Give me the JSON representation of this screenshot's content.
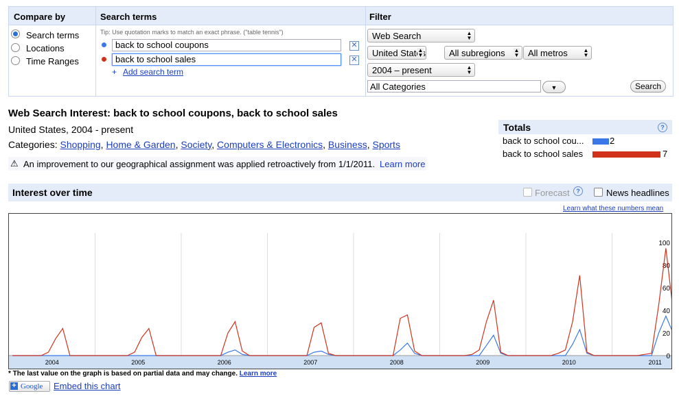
{
  "compare": {
    "header": "Compare by",
    "options": [
      "Search terms",
      "Locations",
      "Time Ranges"
    ],
    "selected": 0
  },
  "search": {
    "header": "Search terms",
    "tip": "Tip: Use quotation marks to match an exact phrase. (\"table tennis\")",
    "terms": [
      {
        "value": "back to school coupons",
        "color": "#3b78e7"
      },
      {
        "value": "back to school sales",
        "color": "#d0321c"
      }
    ],
    "add_label": "Add search term",
    "add_prefix": "+"
  },
  "filter": {
    "header": "Filter",
    "property": "Web Search",
    "country": "United States",
    "subregion": "All subregions",
    "metro": "All metros",
    "time": "2004 – present",
    "category": "All Categories",
    "search_button": "Search"
  },
  "result": {
    "title": "Web Search Interest: back to school coupons, back to school sales",
    "subtitle": "United States, 2004 - present",
    "categories_label": "Categories:",
    "categories": [
      "Shopping",
      "Home & Garden",
      "Society",
      "Computers & Electronics",
      "Business",
      "Sports"
    ],
    "notice": "An improvement to our geographical assignment was applied retroactively from 1/1/2011.",
    "learn_more": "Learn more"
  },
  "totals": {
    "header": "Totals",
    "items": [
      {
        "label": "back to school cou...",
        "value": "2",
        "color": "#3b78e7",
        "level": 2
      },
      {
        "label": "back to school sales",
        "value": "7",
        "color": "#d0321c",
        "level": 7
      }
    ]
  },
  "interest": {
    "header": "Interest over time",
    "forecast": "Forecast",
    "news": "News headlines",
    "learn_numbers": "Learn what these numbers mean",
    "footnote": "* The last value on the graph is based on partial data and may change.",
    "footnote_link": "Learn more"
  },
  "footer": {
    "google": "Google",
    "embed": "Embed this chart"
  },
  "chart_data": {
    "type": "line",
    "x_labels": [
      "2004",
      "2005",
      "2006",
      "2007",
      "2008",
      "2009",
      "2010",
      "2011"
    ],
    "y_ticks": [
      "100",
      "80",
      "60",
      "40",
      "20",
      "0"
    ],
    "ylim": [
      0,
      100
    ],
    "series": [
      {
        "name": "back to school sales",
        "color": "#d0321c",
        "values": [
          0,
          0,
          0,
          0,
          0,
          3,
          15,
          24,
          0,
          0,
          0,
          0,
          0,
          0,
          0,
          0,
          0,
          3,
          16,
          24,
          0,
          0,
          0,
          0,
          0,
          0,
          0,
          0,
          0,
          0,
          20,
          30,
          4,
          0,
          0,
          0,
          0,
          0,
          0,
          0,
          0,
          0,
          25,
          29,
          2,
          0,
          0,
          0,
          0,
          0,
          0,
          0,
          0,
          0,
          33,
          36,
          4,
          0,
          0,
          0,
          0,
          0,
          0,
          0,
          1,
          5,
          30,
          49,
          3,
          0,
          0,
          0,
          0,
          0,
          0,
          0,
          2,
          5,
          30,
          71,
          3,
          0,
          0,
          0,
          0,
          0,
          0,
          0,
          1,
          2,
          45,
          95,
          40,
          5
        ]
      },
      {
        "name": "back to school coupons",
        "color": "#3b78e7",
        "values": [
          0,
          0,
          0,
          0,
          0,
          0,
          0,
          0,
          0,
          0,
          0,
          0,
          0,
          0,
          0,
          0,
          0,
          0,
          0,
          0,
          0,
          0,
          0,
          0,
          0,
          0,
          0,
          0,
          0,
          0,
          3,
          5,
          1,
          0,
          0,
          0,
          0,
          0,
          0,
          0,
          0,
          0,
          3,
          4,
          1,
          0,
          0,
          0,
          0,
          0,
          0,
          0,
          0,
          0,
          5,
          11,
          2,
          0,
          0,
          0,
          0,
          0,
          0,
          0,
          0,
          0,
          9,
          18,
          2,
          0,
          0,
          0,
          0,
          0,
          0,
          0,
          0,
          0,
          10,
          23,
          2,
          0,
          0,
          0,
          0,
          0,
          0,
          0,
          0,
          0,
          20,
          35,
          20,
          5
        ]
      }
    ]
  }
}
